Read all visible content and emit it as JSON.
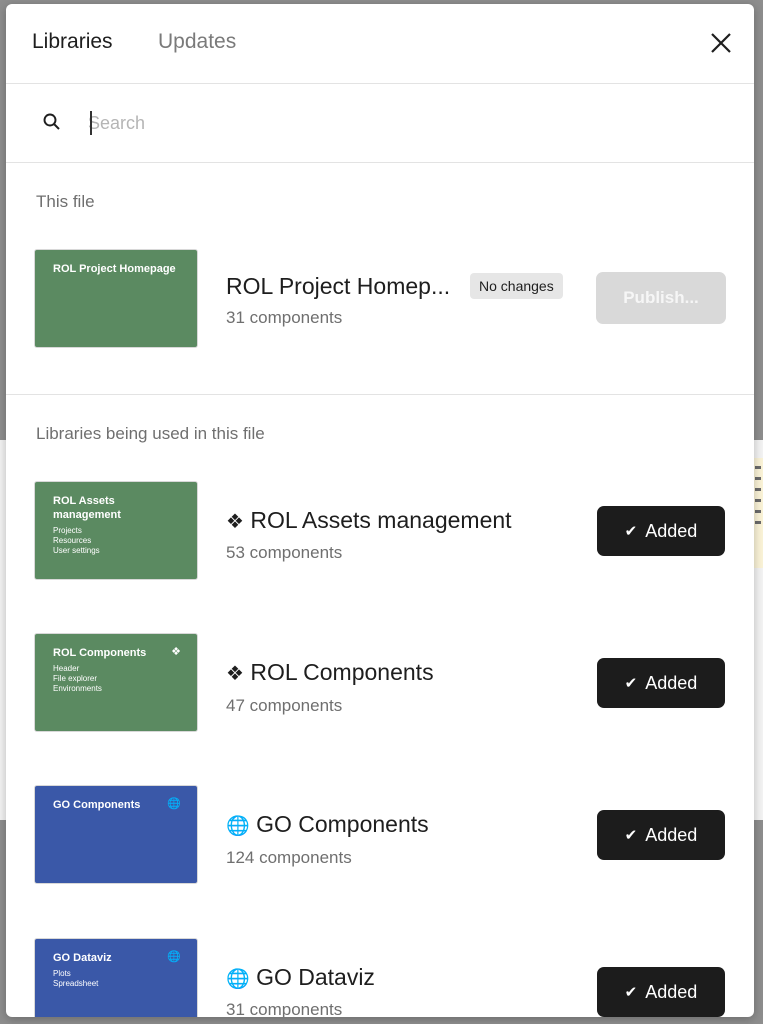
{
  "tabs": [
    {
      "label": "Libraries",
      "active": true
    },
    {
      "label": "Updates",
      "active": false
    }
  ],
  "search": {
    "placeholder": "Search",
    "value": ""
  },
  "this_file": {
    "section_title": "This file",
    "library": {
      "thumb_title": "ROL Project Homepage",
      "name": "ROL Project Homep...",
      "count": "31 components",
      "badge": "No changes",
      "action_label": "Publish..."
    }
  },
  "used_libraries": {
    "section_title": "Libraries being used in this file",
    "items": [
      {
        "thumb_title": "ROL Assets management",
        "thumb_lines": [
          "Projects",
          "Resources",
          "User settings"
        ],
        "thumb_color": "#5b8a61",
        "prefix_glyph": "❖",
        "name": "ROL Assets management",
        "count": "53 components",
        "action_label": "Added"
      },
      {
        "thumb_title": "ROL Components",
        "thumb_lines": [
          "Header",
          "File explorer",
          "Environments"
        ],
        "thumb_color": "#5b8a61",
        "thumb_mark": "❖",
        "prefix_glyph": "❖",
        "name": "ROL Components",
        "count": "47 components",
        "action_label": "Added"
      },
      {
        "thumb_title": "GO Components",
        "thumb_lines": [],
        "thumb_color": "#3a58a8",
        "thumb_mark": "🌐",
        "prefix_glyph": "🌐",
        "name": "GO Components",
        "count": "124 components",
        "action_label": "Added"
      },
      {
        "thumb_title": "GO Dataviz",
        "thumb_lines": [
          "Plots",
          "Spreadsheet"
        ],
        "thumb_color": "#3a58a8",
        "thumb_mark": "🌐",
        "prefix_glyph": "🌐",
        "name": "GO Dataviz",
        "count": "31 components",
        "action_label": "Added"
      }
    ]
  },
  "icons": {
    "close": "close-icon",
    "search": "search-icon",
    "check": "check-icon"
  }
}
